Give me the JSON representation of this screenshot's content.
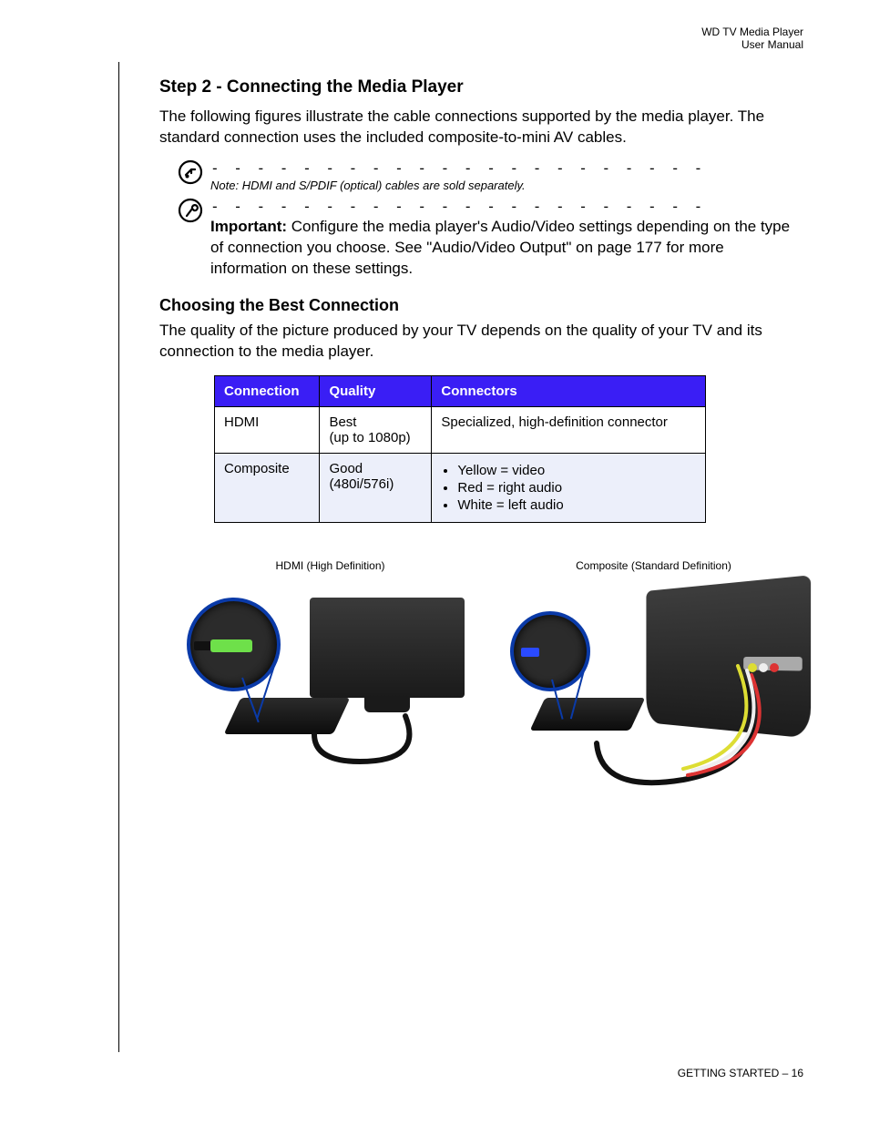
{
  "header": {
    "line1": "WD TV Media Player",
    "line2": "User Manual"
  },
  "step": {
    "title": "Step 2 - Connecting the Media Player",
    "intro": "The following figures illustrate the cable connections supported by the media player. The standard connection uses the included composite-to-mini AV cables."
  },
  "note": {
    "label": "Note",
    "text": ": HDMI and S/PDIF (optical) cables are sold separately."
  },
  "important": {
    "label": "Important:",
    "text": " Configure the media player's Audio/Video settings depending on the type of connection you choose. See \"Audio/Video Output\" on page 177 for more information on these settings."
  },
  "choosing": {
    "title": "Choosing the Best Connection",
    "intro": "The quality of the picture produced by your TV depends on the quality of your TV and its connection to the media player."
  },
  "table": {
    "headers": {
      "connection": "Connection",
      "quality": "Quality",
      "connectors": "Connectors"
    },
    "rows": [
      {
        "connection": "HDMI",
        "quality_l1": "Best",
        "quality_l2": "(up to 1080p)",
        "connectors_text": "Specialized, high-definition connector",
        "connectors_list": null
      },
      {
        "connection": "Composite",
        "quality_l1": "Good",
        "quality_l2": "(480i/576i)",
        "connectors_text": null,
        "connectors_list": [
          "Yellow = video",
          "Red = right audio",
          "White = left audio"
        ]
      }
    ]
  },
  "figures": {
    "hdmi_caption": "HDMI (High Definition)",
    "composite_caption": "Composite (Standard Definition)"
  },
  "footer": {
    "section": "GETTING STARTED",
    "sep": " – ",
    "page": "16"
  }
}
